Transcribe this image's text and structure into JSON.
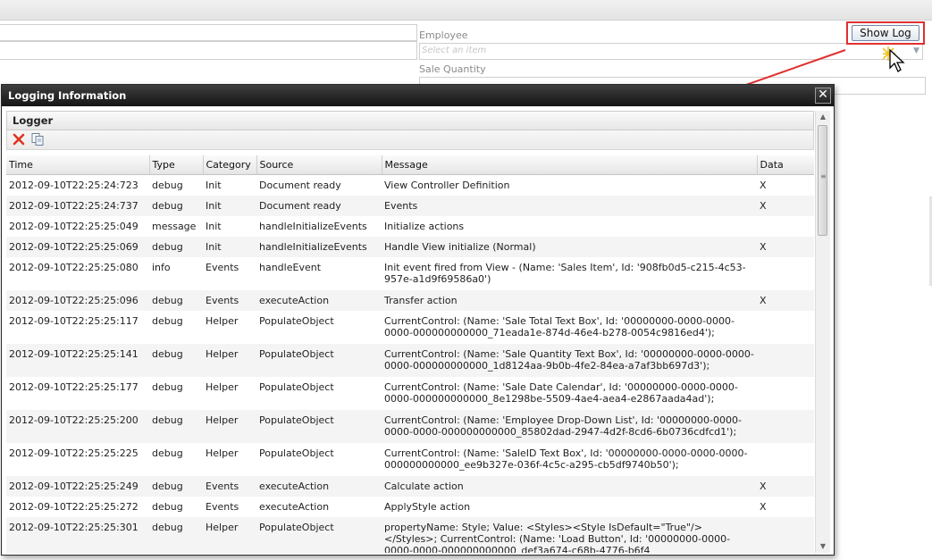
{
  "background_form": {
    "employee_label": "Employee",
    "employee_placeholder": "Select an item",
    "sale_quantity_label": "Sale Quantity",
    "show_log_label": "Show Log"
  },
  "dialog": {
    "title": "Logging Information",
    "panel_title": "Logger",
    "close_glyph": "✕",
    "toolbar_icons": [
      "delete-icon",
      "copy-icon"
    ],
    "columns": [
      "Time",
      "Type",
      "Category",
      "Source",
      "Message",
      "Data"
    ],
    "rows": [
      {
        "time": "2012-09-10T22:25:24:723",
        "type": "debug",
        "category": "Init",
        "source": "Document ready",
        "message": "View Controller Definition",
        "data": "X"
      },
      {
        "time": "2012-09-10T22:25:24:737",
        "type": "debug",
        "category": "Init",
        "source": "Document ready",
        "message": "Events",
        "data": "X"
      },
      {
        "time": "2012-09-10T22:25:25:049",
        "type": "message",
        "category": "Init",
        "source": "handleInitializeEvents",
        "message": "Initialize actions",
        "data": ""
      },
      {
        "time": "2012-09-10T22:25:25:069",
        "type": "debug",
        "category": "Init",
        "source": "handleInitializeEvents",
        "message": "Handle View initialize (Normal)",
        "data": "X"
      },
      {
        "time": "2012-09-10T22:25:25:080",
        "type": "info",
        "category": "Events",
        "source": "handleEvent",
        "message": "Init event fired from View - (Name: 'Sales Item', Id: '908fb0d5-c215-4c53-957e-a1d9f69586a0')",
        "data": ""
      },
      {
        "time": "2012-09-10T22:25:25:096",
        "type": "debug",
        "category": "Events",
        "source": "executeAction",
        "message": "Transfer action",
        "data": "X"
      },
      {
        "time": "2012-09-10T22:25:25:117",
        "type": "debug",
        "category": "Helper",
        "source": "PopulateObject",
        "message": "CurrentControl: (Name: 'Sale Total Text Box', Id: '00000000-0000-0000-0000-000000000000_71eada1e-874d-46e4-b278-0054c9816ed4');",
        "data": ""
      },
      {
        "time": "2012-09-10T22:25:25:141",
        "type": "debug",
        "category": "Helper",
        "source": "PopulateObject",
        "message": "CurrentControl: (Name: 'Sale Quantity Text Box', Id: '00000000-0000-0000-0000-000000000000_1d8124aa-9b0b-4fe2-84ea-a7af3bb697d3');",
        "data": ""
      },
      {
        "time": "2012-09-10T22:25:25:177",
        "type": "debug",
        "category": "Helper",
        "source": "PopulateObject",
        "message": "CurrentControl: (Name: 'Sale Date Calendar', Id: '00000000-0000-0000-0000-000000000000_8e1298be-5509-4ae4-aea4-e2867aada4ad');",
        "data": ""
      },
      {
        "time": "2012-09-10T22:25:25:200",
        "type": "debug",
        "category": "Helper",
        "source": "PopulateObject",
        "message": "CurrentControl: (Name: 'Employee Drop-Down List', Id: '00000000-0000-0000-0000-000000000000_85802dad-2947-4d2f-8cd6-6b0736cdfcd1');",
        "data": ""
      },
      {
        "time": "2012-09-10T22:25:25:225",
        "type": "debug",
        "category": "Helper",
        "source": "PopulateObject",
        "message": "CurrentControl: (Name: 'SaleID Text Box', Id: '00000000-0000-0000-0000-000000000000_ee9b327e-036f-4c5c-a295-cb5df9740b50');",
        "data": ""
      },
      {
        "time": "2012-09-10T22:25:25:249",
        "type": "debug",
        "category": "Events",
        "source": "executeAction",
        "message": "Calculate action",
        "data": "X"
      },
      {
        "time": "2012-09-10T22:25:25:272",
        "type": "debug",
        "category": "Events",
        "source": "executeAction",
        "message": "ApplyStyle action",
        "data": "X"
      },
      {
        "time": "2012-09-10T22:25:25:301",
        "type": "debug",
        "category": "Helper",
        "source": "PopulateObject",
        "message": "propertyName: Style; Value: <Styles><Style IsDefault=\"True\"/></Styles>; CurrentControl: (Name: 'Load Button', Id: '00000000-0000-0000-0000-000000000000_def3a674-c68b-4776-b6f4",
        "data": ""
      }
    ]
  },
  "colors": {
    "annotation_red": "#e03030",
    "title_bar": "#1e1e1e"
  }
}
